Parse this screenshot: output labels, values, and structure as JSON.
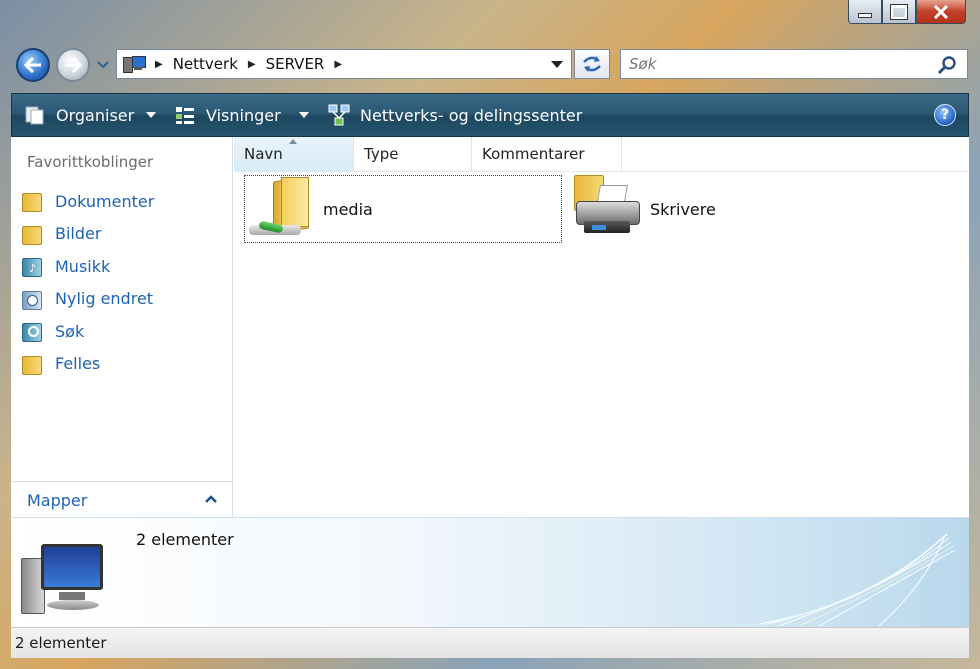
{
  "window": {
    "controls": [
      "minimize-icon",
      "maximize-icon",
      "close-icon"
    ]
  },
  "address": {
    "crumbs": [
      "Nettverk",
      "SERVER"
    ],
    "search_placeholder": "Søk"
  },
  "toolbar": {
    "organise": "Organiser",
    "views": "Visninger",
    "network_center": "Nettverks- og delingssenter"
  },
  "nav": {
    "title": "Favorittkoblinger",
    "items": [
      {
        "label": "Dokumenter",
        "icon": "folder-icon"
      },
      {
        "label": "Bilder",
        "icon": "folder-icon"
      },
      {
        "label": "Musikk",
        "icon": "music-folder-icon"
      },
      {
        "label": "Nylig endret",
        "icon": "recent-folder-icon"
      },
      {
        "label": "Søk",
        "icon": "search-folder-icon"
      },
      {
        "label": "Felles",
        "icon": "folder-icon"
      }
    ],
    "folders_label": "Mapper"
  },
  "columns": [
    "Navn",
    "Type",
    "Kommentarer"
  ],
  "items": [
    {
      "name": "media",
      "icon": "shared-folder-icon"
    },
    {
      "name": "Skrivere",
      "icon": "printer-folder-icon"
    }
  ],
  "details": {
    "count": "2 elementer"
  },
  "status": {
    "text": "2 elementer"
  },
  "colors": {
    "link": "#1d63b5",
    "toolbar": "#2a5772"
  }
}
